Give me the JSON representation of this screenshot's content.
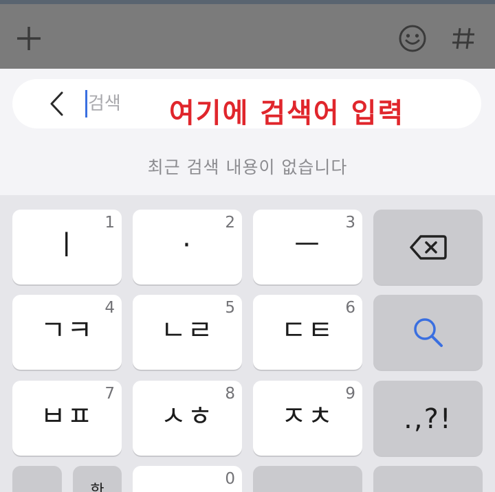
{
  "toolbar": {
    "icons": [
      "plus-icon",
      "emoji-icon",
      "hashtag-icon"
    ]
  },
  "search": {
    "placeholder": "검색",
    "annotation": "여기에 검색어 입력",
    "empty_message": "최근 검색 내용이 없습니다"
  },
  "keyboard": {
    "rows": [
      [
        {
          "num": "1",
          "label": "ㅣ"
        },
        {
          "num": "2",
          "label": "·"
        },
        {
          "num": "3",
          "label": "ㅡ"
        },
        {
          "icon": "backspace-icon"
        }
      ],
      [
        {
          "num": "4",
          "label": "ㄱㅋ"
        },
        {
          "num": "5",
          "label": "ㄴㄹ"
        },
        {
          "num": "6",
          "label": "ㄷㅌ"
        },
        {
          "icon": "search-icon"
        }
      ],
      [
        {
          "num": "7",
          "label": "ㅂㅍ"
        },
        {
          "num": "8",
          "label": "ㅅㅎ"
        },
        {
          "num": "9",
          "label": "ㅈㅊ"
        },
        {
          "label": ".,?!"
        }
      ],
      [
        {
          "label": ""
        },
        {
          "label": "한"
        },
        {
          "num": "0",
          "label": ""
        },
        {
          "label": ""
        },
        {
          "label": ""
        }
      ]
    ]
  },
  "colors": {
    "annotation": "#e0262c",
    "caret": "#3a6fe0",
    "search_icon": "#3a6fe0",
    "toolbar_bg": "#7b7b7b",
    "key_bg": "#ffffff",
    "func_key_bg": "#cacace"
  }
}
